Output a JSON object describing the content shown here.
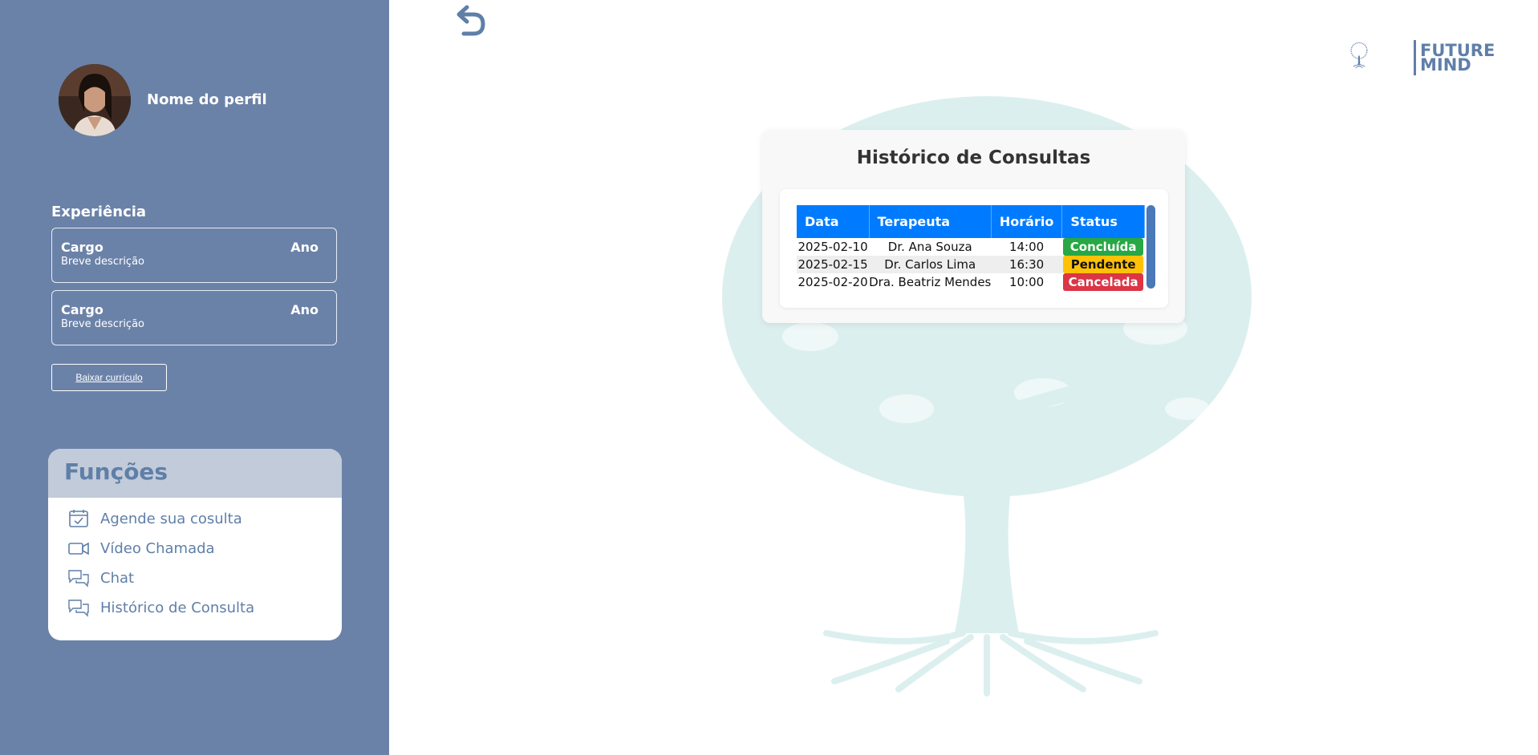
{
  "profile": {
    "name": "Nome do perfil"
  },
  "experience": {
    "title": "Experiência",
    "items": [
      {
        "role": "Cargo",
        "year": "Ano",
        "desc": "Breve descrição"
      },
      {
        "role": "Cargo",
        "year": "Ano",
        "desc": "Breve descrição"
      }
    ],
    "download_label": "Baixar currículo"
  },
  "functions": {
    "title": "Funções",
    "items": [
      {
        "label": "Agende sua cosulta",
        "icon": "calendar-check-icon"
      },
      {
        "label": "Vídeo Chamada",
        "icon": "video-camera-icon"
      },
      {
        "label": "Chat",
        "icon": "chat-bubbles-icon"
      },
      {
        "label": "Histórico de Consulta",
        "icon": "chat-bubbles-icon"
      }
    ]
  },
  "logo": {
    "line1": "FUTURE",
    "line2": "MIND"
  },
  "history": {
    "title": "Histórico de Consultas",
    "columns": [
      "Data",
      "Terapeuta",
      "Horário",
      "Status"
    ],
    "rows": [
      {
        "date": "2025-02-10",
        "therapist": "Dr. Ana Souza",
        "time": "14:00",
        "status": "Concluída"
      },
      {
        "date": "2025-02-15",
        "therapist": "Dr. Carlos Lima",
        "time": "16:30",
        "status": "Pendente"
      },
      {
        "date": "2025-02-20",
        "therapist": "Dra. Beatriz Mendes",
        "time": "10:00",
        "status": "Cancelada"
      }
    ]
  },
  "colors": {
    "sidebar_bg": "#6b82a8",
    "accent": "#5f7fa8",
    "table_header": "#007bff",
    "status_done": "#28a745",
    "status_pending": "#ffc107",
    "status_cancelled": "#dc3545"
  }
}
